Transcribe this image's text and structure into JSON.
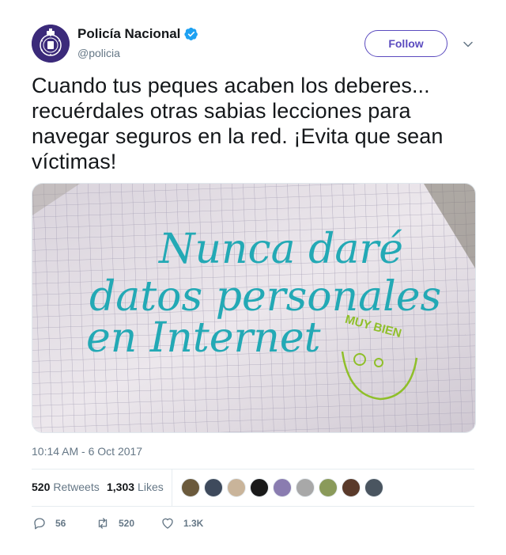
{
  "header": {
    "display_name": "Policía Nacional",
    "handle": "@policia",
    "follow_label": "Follow",
    "verified_icon": "verified-badge-icon",
    "more_icon": "chevron-down-icon"
  },
  "tweet": {
    "text": "Cuando tus peques acaben los deberes... recuérdales otras sabias lecciones para navegar seguros en la red. ¡Evita que sean víctimas!",
    "image_text": {
      "line1": "Nunca daré",
      "line2": "datos personales",
      "line3": "en Internet",
      "stamp": "MUY BIEN"
    },
    "timestamp": "10:14 AM - 6 Oct 2017"
  },
  "stats": {
    "retweets_count": "520",
    "retweets_label": "Retweets",
    "likes_count": "1,303",
    "likes_label": "Likes",
    "liker_colors": [
      "#6b5a3c",
      "#3e4a5c",
      "#c9b49a",
      "#1a1a1a",
      "#8a7cb0",
      "#a8a8a8",
      "#8a9a5a",
      "#5a3a2a",
      "#4a5560"
    ]
  },
  "actions": {
    "replies": "56",
    "retweets": "520",
    "likes": "1.3K"
  },
  "colors": {
    "brand_purple": "#5b4bbf",
    "verified_blue": "#1da1f2",
    "muted": "#657786",
    "ink_blue": "#23a9b5",
    "ink_green": "#8fbf2a"
  }
}
